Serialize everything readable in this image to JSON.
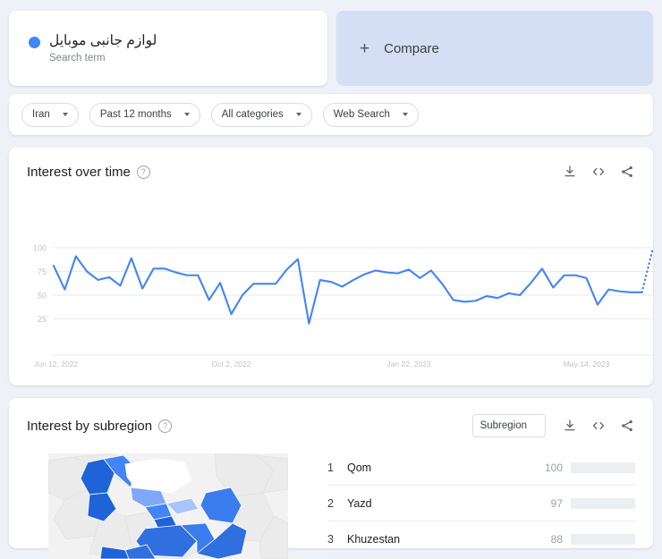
{
  "search_term": {
    "term": "لوازم جانبی موبایل",
    "type_label": "Search term",
    "dot_color": "#4285f4"
  },
  "compare": {
    "plus": "+",
    "label": "Compare"
  },
  "filters": [
    {
      "label": "Iran"
    },
    {
      "label": "Past 12 months"
    },
    {
      "label": "All categories"
    },
    {
      "label": "Web Search"
    }
  ],
  "interest_over_time": {
    "title": "Interest over time",
    "help": "?",
    "actions": [
      "download-icon",
      "embed-icon",
      "share-icon"
    ]
  },
  "interest_by_subregion": {
    "title": "Interest by subregion",
    "help": "?",
    "select_label": "Subregion",
    "actions": [
      "download-icon",
      "embed-icon",
      "share-icon"
    ],
    "rows": [
      {
        "rank": "1",
        "name": "Qom",
        "value": "100",
        "pct": 100
      },
      {
        "rank": "2",
        "name": "Yazd",
        "value": "97",
        "pct": 97
      },
      {
        "rank": "3",
        "name": "Khuzestan",
        "value": "88",
        "pct": 88
      }
    ]
  },
  "chart_data": {
    "type": "line",
    "title": "Interest over time",
    "xlabel": "",
    "ylabel": "",
    "ylim": [
      0,
      100
    ],
    "yticks": [
      25,
      50,
      75,
      100
    ],
    "grid": true,
    "legend": false,
    "line_color": "#4285f4",
    "x_tick_labels": [
      "Jun 12, 2022",
      "Oct 2, 2022",
      "Jan 22, 2023",
      "May 14, 2023"
    ],
    "x_tick_indices": [
      0,
      16,
      32,
      48
    ],
    "series": [
      {
        "name": "لوازم جانبی موبایل",
        "values": [
          81,
          56,
          91,
          75,
          66,
          69,
          60,
          89,
          57,
          78,
          78,
          74,
          71,
          71,
          45,
          63,
          30,
          50,
          62,
          62,
          62,
          77,
          88,
          20,
          66,
          64,
          59,
          66,
          72,
          76,
          74,
          73,
          77,
          68,
          76,
          62,
          45,
          43,
          44,
          49,
          47,
          52,
          50,
          63,
          78,
          58,
          71,
          71,
          68,
          40,
          56,
          54,
          53,
          53,
          100
        ],
        "dashed_from_index": 53
      }
    ],
    "annotations": [
      "Final segment drawn as a dotted line indicating partial / incomplete data"
    ]
  }
}
